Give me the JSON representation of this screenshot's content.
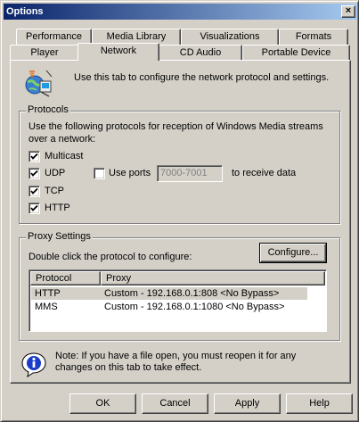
{
  "window": {
    "title": "Options",
    "close_glyph": "×"
  },
  "tabs": {
    "row1": [
      {
        "label": "Performance"
      },
      {
        "label": "Media Library"
      },
      {
        "label": "Visualizations"
      },
      {
        "label": "Formats"
      }
    ],
    "row2": [
      {
        "label": "Player"
      },
      {
        "label": "Network",
        "active": true
      },
      {
        "label": "CD Audio"
      },
      {
        "label": "Portable Device"
      }
    ]
  },
  "intro": {
    "icon": "network-globe-icon",
    "text": "Use this tab to configure the network protocol and settings."
  },
  "protocols": {
    "title": "Protocols",
    "description_line1": "Use the following protocols for reception of Windows Media streams",
    "description_line2": "over a network:",
    "items": [
      {
        "label": "Multicast",
        "checked": true
      },
      {
        "label": "UDP",
        "checked": true
      },
      {
        "label": "TCP",
        "checked": true
      },
      {
        "label": "HTTP",
        "checked": true
      }
    ],
    "use_ports": {
      "label": "Use ports",
      "checked": false,
      "value": "7000-7001",
      "suffix": "to receive data"
    }
  },
  "proxy": {
    "title": "Proxy Settings",
    "instruction": "Double click the protocol to configure:",
    "configure_label": "Configure...",
    "columns": [
      "Protocol",
      "Proxy"
    ],
    "rows": [
      {
        "protocol": "HTTP",
        "proxy": "Custom - 192.168.0.1:808 <No Bypass>",
        "selected": true
      },
      {
        "protocol": "MMS",
        "proxy": "Custom - 192.168.0.1:1080 <No Bypass>",
        "selected": false
      }
    ]
  },
  "note": {
    "icon": "info-icon",
    "line1": "Note: If you have a file open, you must reopen it for any",
    "line2": "changes on this tab to take effect."
  },
  "buttons": {
    "ok": "OK",
    "cancel": "Cancel",
    "apply": "Apply",
    "help": "Help"
  },
  "colors": {
    "titlebar_start": "#0a246a",
    "titlebar_end": "#a6caf0",
    "face": "#d4d0c8"
  }
}
